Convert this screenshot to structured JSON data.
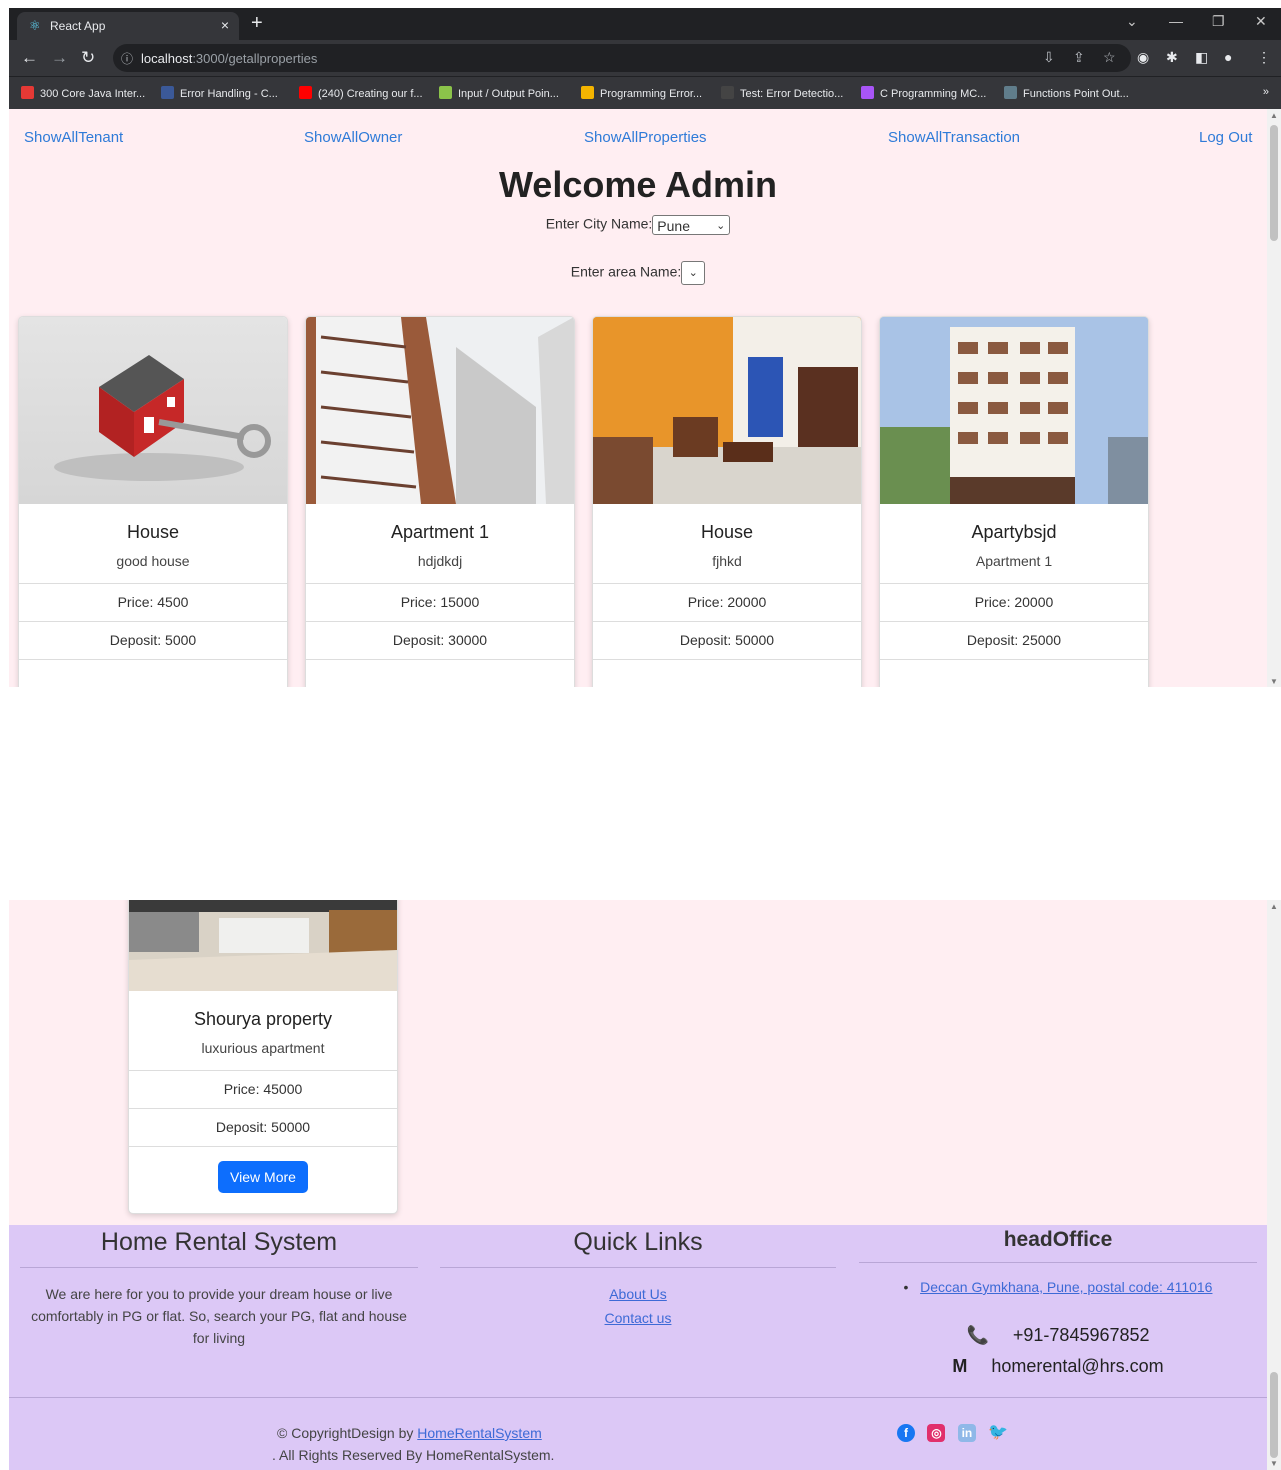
{
  "browser": {
    "tab_title": "React App",
    "tab_close": "×",
    "new_tab": "+",
    "url_host": "localhost",
    "url_path": ":3000/getallproperties",
    "bookmarks": [
      {
        "label": "300 Core Java Inter...",
        "icon": "red-v-icon",
        "color": "#e53935"
      },
      {
        "label": "Error Handling - C...",
        "icon": "site-icon",
        "color": "#3b5998"
      },
      {
        "label": "(240) Creating our f...",
        "icon": "youtube-icon",
        "color": "#ff0000"
      },
      {
        "label": "Input / Output Poin...",
        "icon": "leaf-icon",
        "color": "#8bc34a"
      },
      {
        "label": "Programming Error...",
        "icon": "site-icon",
        "color": "#f4b400"
      },
      {
        "label": "Test: Error Detectio...",
        "icon": "er-icon",
        "color": "#444444"
      },
      {
        "label": "C Programming MC...",
        "icon": "site-icon",
        "color": "#a855f7"
      },
      {
        "label": "Functions Point Out...",
        "icon": "site-icon",
        "color": "#607d8b"
      }
    ]
  },
  "nav": {
    "tenant": "ShowAllTenant",
    "owner": "ShowAllOwner",
    "properties": "ShowAllProperties",
    "transaction": "ShowAllTransaction",
    "logout": "Log Out"
  },
  "header": {
    "welcome": "Welcome Admin",
    "city_label": "Enter City Name:",
    "city_value": "Pune",
    "area_label": "Enter area Name:"
  },
  "properties": [
    {
      "title": "House",
      "desc": "good house",
      "price": "Price: 4500",
      "deposit": "Deposit: 5000"
    },
    {
      "title": "Apartment 1",
      "desc": "hdjdkdj",
      "price": "Price: 15000",
      "deposit": "Deposit: 30000"
    },
    {
      "title": "House",
      "desc": "fjhkd",
      "price": "Price: 20000",
      "deposit": "Deposit: 50000"
    },
    {
      "title": "Apartybsjd",
      "desc": "Apartment 1",
      "price": "Price: 20000",
      "deposit": "Deposit: 25000"
    },
    {
      "title": "Shourya property",
      "desc": "luxurious apartment",
      "price": "Price: 45000",
      "deposit": "Deposit: 50000",
      "button": "View More"
    }
  ],
  "footer": {
    "brand_title": "Home Rental System",
    "brand_text_1": "We are here for you to provide your dream house or live",
    "brand_text_2": "comfortably in PG or flat. So, search your PG, flat and house",
    "brand_text_3": "for living",
    "links_title": "Quick Links",
    "about": "About Us",
    "contact": "Contact us",
    "office_title": "headOffice",
    "address": "Deccan Gymkhana, Pune, postal code: 411016",
    "phone": "+91-7845967852",
    "email": "homerental@hrs.com",
    "copyright_prefix": "© CopyrightDesign by ",
    "copyright_link": "HomeRentalSystem",
    "copyright_suffix": ". All Rights Reserved By HomeRentalSystem.",
    "social": [
      "facebook-icon",
      "instagram-icon",
      "linkedin-icon",
      "twitter-icon"
    ]
  },
  "colors": {
    "page_bg": "#ffeef2",
    "footer_bg": "#dcc8f6",
    "link": "#2f7bd8",
    "button": "#0d6efd"
  }
}
